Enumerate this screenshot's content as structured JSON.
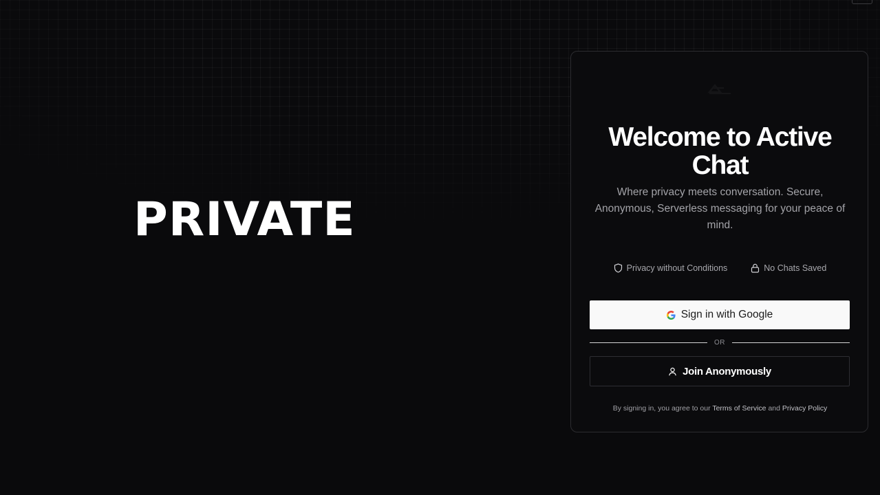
{
  "hero": {
    "word": "PRIVATE"
  },
  "card": {
    "title": "Welcome to Active Chat",
    "subtitle": "Where privacy meets conversation. Secure, Anonymous, Serverless messaging for your peace of mind.",
    "features": [
      {
        "icon": "shield-icon",
        "label": "Privacy without Conditions"
      },
      {
        "icon": "lock-icon",
        "label": "No Chats Saved"
      }
    ],
    "google_button": {
      "label": "Sign in with Google",
      "icon": "google-icon"
    },
    "divider": "OR",
    "anon_button": {
      "label": "Join Anonymously",
      "icon": "user-icon"
    },
    "terms": {
      "prefix": "By signing in, you agree to our",
      "tos": "Terms of Service",
      "and": "and",
      "privacy": "Privacy Policy"
    }
  },
  "colors": {
    "background": "#0a0a0c",
    "card_background": "#0b0b0d",
    "card_border": "#2c2c30",
    "text_primary": "#ffffff",
    "text_muted": "#a3a3a8",
    "google_button_bg": "#f9f9f9"
  }
}
